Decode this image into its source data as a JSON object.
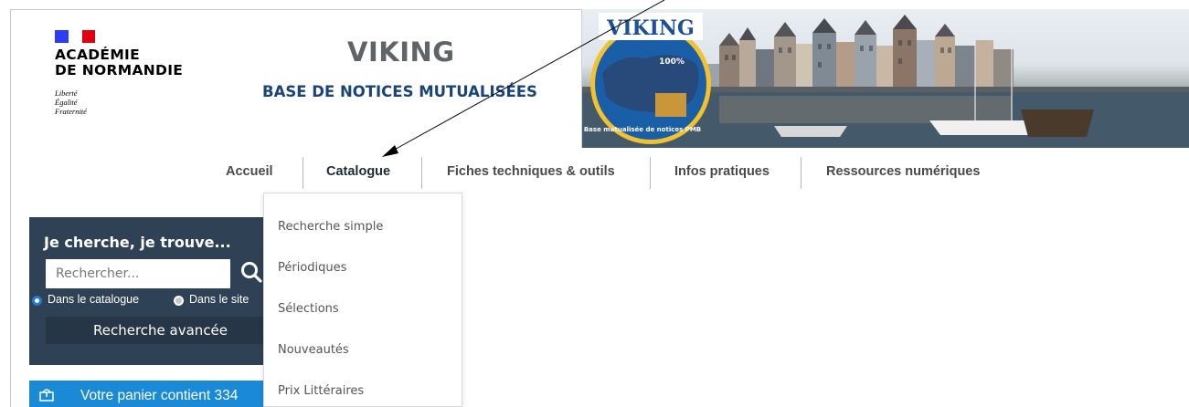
{
  "logo": {
    "line1": "ACADÉMIE",
    "line2": "DE NORMANDIE",
    "motto1": "Liberté",
    "motto2": "Égalité",
    "motto3": "Fraternité",
    "flag_colors": [
      "#2d3df4",
      "#ffffff",
      "#e1000f"
    ]
  },
  "header": {
    "title": "VIKING",
    "subtitle": "BASE DE NOTICES MUTUALISÉES"
  },
  "banner": {
    "badge_title": "VIKING",
    "badge_small": "100%",
    "badge_caption": "Base mutualisée de notices PMB"
  },
  "nav": {
    "items": [
      {
        "label": "Accueil"
      },
      {
        "label": "Catalogue"
      },
      {
        "label": "Fiches techniques & outils"
      },
      {
        "label": "Infos pratiques"
      },
      {
        "label": "Ressources numériques"
      }
    ],
    "active": "Catalogue"
  },
  "catalogue_menu": {
    "items": [
      {
        "label": "Recherche simple"
      },
      {
        "label": "Périodiques"
      },
      {
        "label": "Sélections"
      },
      {
        "label": "Nouveautés"
      },
      {
        "label": "Prix Littéraires"
      }
    ]
  },
  "search": {
    "title": "Je cherche, je trouve...",
    "placeholder": "Rechercher...",
    "option_catalogue": "Dans le catalogue",
    "option_site": "Dans le site",
    "selected_option": "Dans le catalogue",
    "advanced_label": "Recherche avancée",
    "panel_color": "#2f4154"
  },
  "cart": {
    "text": "Votre panier contient 334",
    "color": "#1b8ad6"
  },
  "colors": {
    "title_gray": "#5f6468",
    "subtitle_blue": "#1a4478"
  }
}
